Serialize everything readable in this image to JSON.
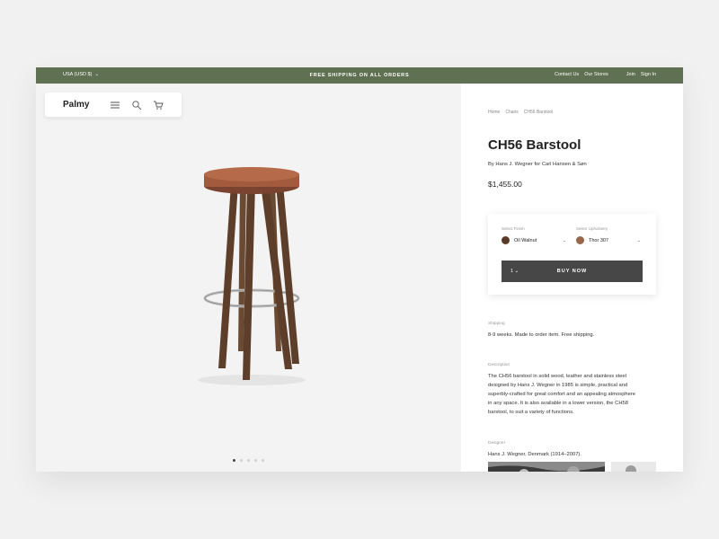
{
  "topbar": {
    "currency": "USA (USD $)",
    "promo": "FREE SHIPPING ON ALL ORDERS",
    "links": [
      "Contact Us",
      "Our Stores",
      "Join",
      "Sign In"
    ]
  },
  "nav": {
    "logo": "Palmy",
    "icons": [
      "menu-icon",
      "search-icon",
      "cart-icon"
    ]
  },
  "gallery": {
    "dots": 5,
    "active": 0
  },
  "product": {
    "breadcrumb": [
      "Home",
      "Chairs",
      "CH56 Barstool"
    ],
    "title": "CH56 Barstool",
    "byline": "By Hans J. Wegner for Carl Hansen & Søn",
    "price": "$1,455.00",
    "finish": {
      "label": "Select Finish",
      "value": "Oil Walnut",
      "color": "#5a3a26"
    },
    "upholstery": {
      "label": "Select Upholstery",
      "value": "Thor 307",
      "color": "#9a6649"
    },
    "quantity": "1",
    "buy_label": "BUY NOW",
    "shipping": {
      "label": "Shipping",
      "text": "8-9 weeks. Made to order item. Free shipping."
    },
    "description": {
      "label": "Description",
      "lines": [
        "The CH56 barstool in solid wood, leather and stainless steel",
        "designed by Hans J. Wegner in 1985 is simple, practical and",
        "superbly-crafted for great comfort and an appealing atmosphere",
        "in any space. It is also available in a lower version, the CH58",
        "barstool, to suit a variety of functions."
      ]
    },
    "designer": {
      "label": "Designer",
      "text": "Hans J. Wegner, Denmark (1914–2007)."
    }
  },
  "colors": {
    "topbar": "#5f7152",
    "button": "#474747"
  }
}
